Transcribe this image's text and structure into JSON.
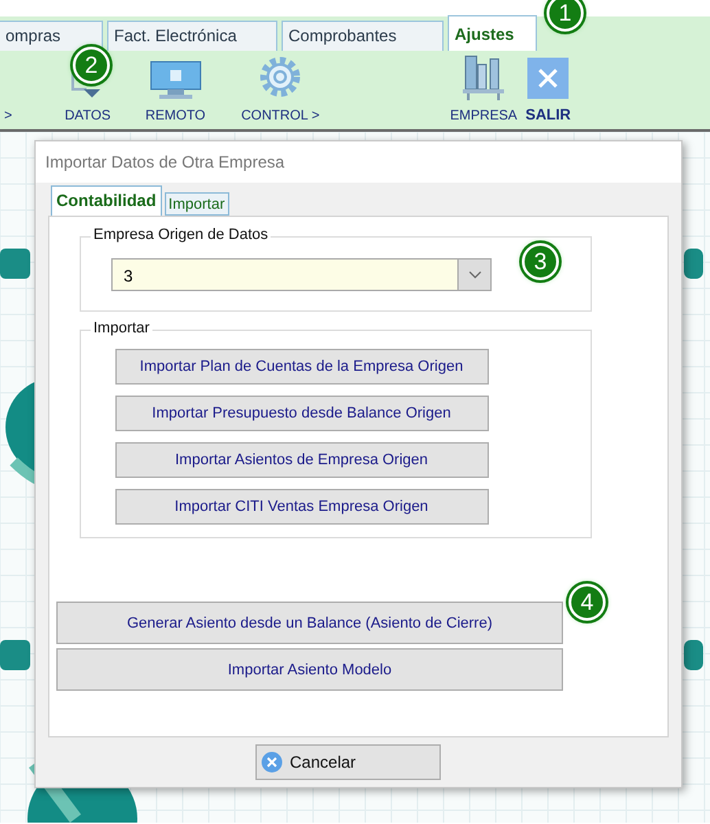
{
  "tabs": [
    {
      "label": "ompras",
      "selected": false
    },
    {
      "label": "Fact. Electrónica",
      "selected": false
    },
    {
      "label": "Comprobantes",
      "selected": false
    },
    {
      "label": "Ajustes",
      "selected": true
    }
  ],
  "toolbar": [
    {
      "label": ">",
      "kind": "text"
    },
    {
      "label": "DATOS",
      "kind": "datos"
    },
    {
      "label": "REMOTO",
      "kind": "remoto"
    },
    {
      "label": "CONTROL >",
      "kind": "control"
    },
    {
      "label": "EMPRESA",
      "kind": "empresa"
    },
    {
      "label": "SALIR",
      "kind": "salir"
    }
  ],
  "dialog": {
    "title": "Importar Datos de Otra Empresa",
    "tabs": [
      {
        "label": "Contabilidad",
        "selected": true
      },
      {
        "label": "Importar",
        "selected": false
      }
    ],
    "origin_group": {
      "legend": "Empresa  Origen de Datos",
      "combo_value": "3"
    },
    "import_group": {
      "legend": "Importar",
      "buttons": [
        "Importar Plan de Cuentas de la Empresa Origen",
        "Importar Presupuesto desde Balance Origen",
        "Importar Asientos de Empresa Origen",
        "Importar CITI Ventas Empresa Origen"
      ]
    },
    "buttons": [
      "Generar  Asiento desde un Balance (Asiento de Cierre)",
      "Importar Asiento Modelo"
    ],
    "cancel": "Cancelar"
  },
  "callouts": [
    {
      "label": "1",
      "kind": "c1"
    },
    {
      "label": "2",
      "kind": "c2"
    },
    {
      "label": "3",
      "kind": "c3"
    },
    {
      "label": "4",
      "kind": "c4"
    }
  ]
}
